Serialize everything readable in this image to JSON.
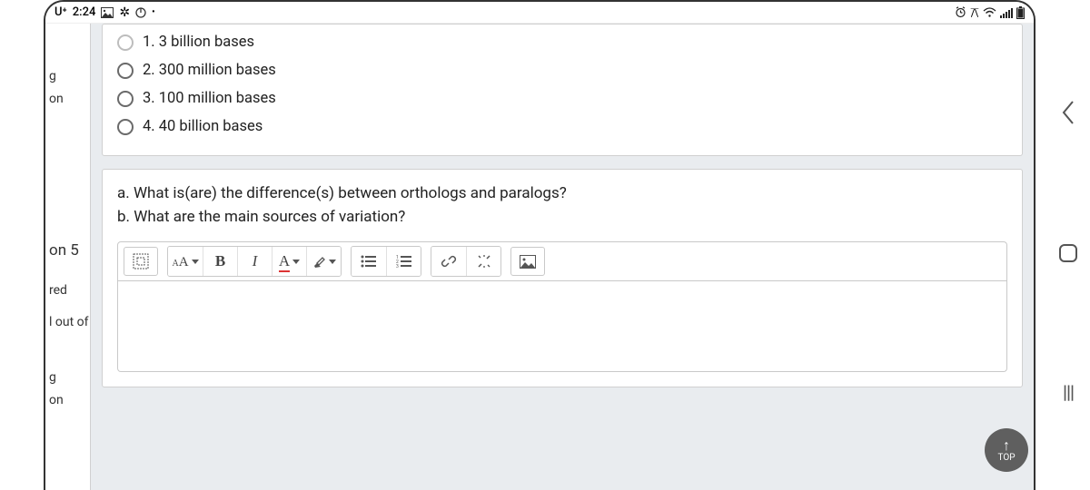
{
  "status": {
    "carrier": "U⁺",
    "time": "2:24"
  },
  "sidebar": {
    "line1": "g",
    "line2": "on",
    "qnum": "on 5",
    "l3": "red",
    "l4": "l out of",
    "l5": "g",
    "l6": "on"
  },
  "q4": {
    "options": [
      {
        "label": "1. 3 billion bases",
        "light": true
      },
      {
        "label": "2. 300 million bases",
        "light": false
      },
      {
        "label": "3. 100 million bases",
        "light": false
      },
      {
        "label": "4. 40 billion bases",
        "light": false
      }
    ]
  },
  "q5": {
    "prompt_a": "a. What is(are) the difference(s) between orthologs and paralogs?",
    "prompt_b": "b. What are the main sources of variation?"
  },
  "toolbar": {
    "bold": "B",
    "italic": "I"
  },
  "topbtn": {
    "label": "TOP"
  }
}
